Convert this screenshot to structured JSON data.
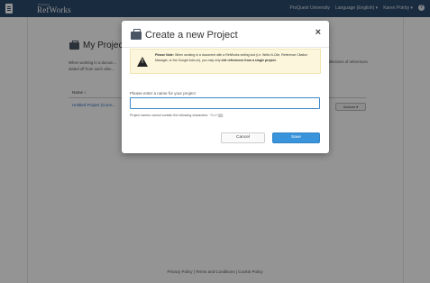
{
  "app": {
    "brand_small": "ProQuest",
    "brand": "RefWorks",
    "nav": {
      "institution": "ProQuest University",
      "language": "Language (English) ▾",
      "user": "Karen Poirby ▾",
      "help_icon": "question-circle-icon"
    }
  },
  "page": {
    "title": "My Projects",
    "description_left": "When working in a docum...\nstated off from each othe...",
    "description_right": "...ollections of references",
    "table": {
      "header_name": "Name ↕"
    },
    "projects": [
      {
        "name": "Untitled Project (Curre..."
      }
    ],
    "actions_label": "Actions ▾",
    "footer": "Privacy Policy  |  Terms and Conditions  |  Cookie Policy"
  },
  "modal": {
    "title": "Create a new Project",
    "close_label": "×",
    "note": {
      "prefix": "Please Note:",
      "text": "When working in a document with a RefWorks writing tool (i.e. Write-N-Cite, Reference Citation Manager, or the Google Add-on), you may only ",
      "emphasis": "cite references from a single project."
    },
    "name_label": "Please enter a name for your project",
    "name_value": "",
    "name_hint": "Project names cannot contain the following characters: ~!\\<>^|{}[]",
    "cancel_label": "Cancel",
    "save_label": "Save"
  },
  "colors": {
    "topbar": "#2b4a6d",
    "save_button": "#3a94db",
    "input_border": "#3a86c8",
    "note_background": "#fcf7dc",
    "link": "#2a6ebb"
  }
}
